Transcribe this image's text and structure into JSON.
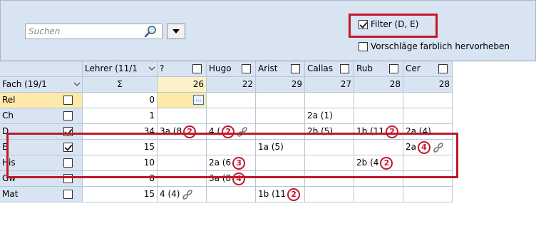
{
  "search": {
    "placeholder": "Suchen"
  },
  "options": {
    "filter_label": "Filter (D, E)",
    "filter_checked": true,
    "highlight_label": "Vorschläge farblich hervorheben",
    "highlight_checked": false
  },
  "grid": {
    "lehrer_header": "Lehrer (11/1",
    "fach_header": "Fach (19/1",
    "sigma": "Σ",
    "teachers": [
      {
        "name": "?",
        "count": "26"
      },
      {
        "name": "Hugo",
        "count": "22"
      },
      {
        "name": "Arist",
        "count": "29"
      },
      {
        "name": "Callas",
        "count": "27"
      },
      {
        "name": "Rub",
        "count": "28"
      },
      {
        "name": "Cer",
        "count": "28"
      }
    ],
    "rows": [
      {
        "fach": "Rel",
        "checked": false,
        "sum": "0",
        "cells": [
          {
            "text": "",
            "button": "..."
          },
          {
            "text": ""
          },
          {
            "text": ""
          },
          {
            "text": ""
          },
          {
            "text": ""
          },
          {
            "text": ""
          }
        ]
      },
      {
        "fach": "Ch",
        "checked": false,
        "sum": "1",
        "cells": [
          {
            "text": ""
          },
          {
            "text": ""
          },
          {
            "text": ""
          },
          {
            "text": "2a (1)"
          },
          {
            "text": ""
          },
          {
            "text": ""
          }
        ]
      },
      {
        "fach": "D",
        "checked": true,
        "sum": "34",
        "cells": [
          {
            "text": "3a (8",
            "badge": "2"
          },
          {
            "text": "4 (",
            "badge": "2",
            "chain": "link-icon"
          },
          {
            "text": ""
          },
          {
            "text": "2b (5)"
          },
          {
            "text": "1b (11",
            "badge": "2"
          },
          {
            "text": "2a (4)"
          }
        ]
      },
      {
        "fach": "E",
        "checked": true,
        "sum": "15",
        "cells": [
          {
            "text": ""
          },
          {
            "text": ""
          },
          {
            "text": "1a (5)"
          },
          {
            "text": ""
          },
          {
            "text": ""
          },
          {
            "text": "2a",
            "badge": "4",
            "chain": "link-icon"
          }
        ]
      },
      {
        "fach": "His",
        "checked": false,
        "sum": "10",
        "cells": [
          {
            "text": ""
          },
          {
            "text": "2a (6",
            "badge": "3"
          },
          {
            "text": ""
          },
          {
            "text": ""
          },
          {
            "text": "2b (4",
            "badge": "2"
          },
          {
            "text": ""
          }
        ]
      },
      {
        "fach": "Gw",
        "checked": false,
        "sum": "8",
        "cells": [
          {
            "text": ""
          },
          {
            "text": "3a (8",
            "badge": "4"
          },
          {
            "text": ""
          },
          {
            "text": ""
          },
          {
            "text": ""
          },
          {
            "text": ""
          }
        ]
      },
      {
        "fach": "Mat",
        "checked": false,
        "sum": "15",
        "cells": [
          {
            "text": "4 (4)",
            "chain": "link-icon"
          },
          {
            "text": ""
          },
          {
            "text": "1b (11",
            "badge": "2"
          },
          {
            "text": ""
          },
          {
            "text": ""
          },
          {
            "text": ""
          }
        ]
      }
    ]
  },
  "colors": {
    "highlight": "#c0182a",
    "header_bg": "#d8e4f2",
    "selected_cell": "#ffe9a8",
    "sum_col_highlight": "#fbf0c8"
  }
}
